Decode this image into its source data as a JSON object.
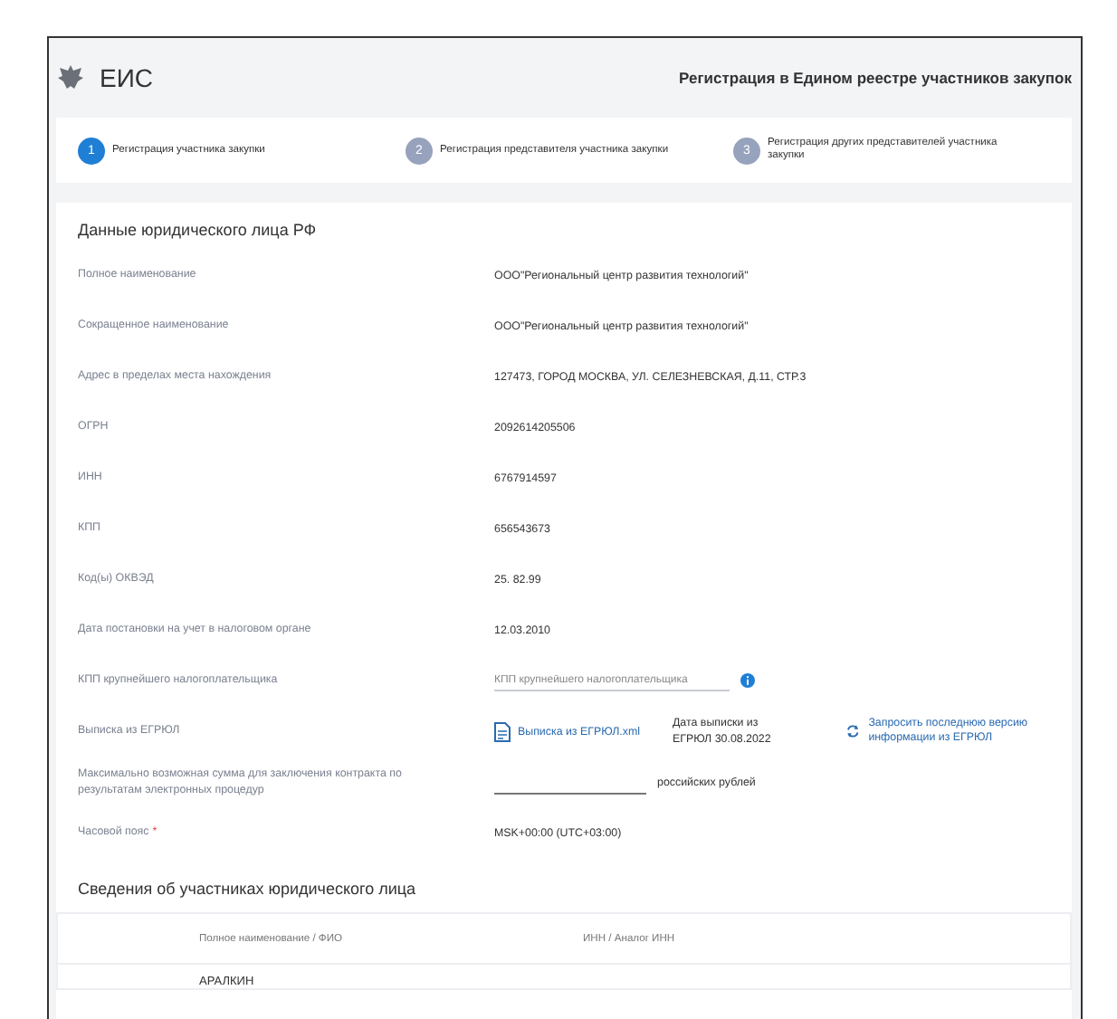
{
  "header": {
    "logo": "ЕИС",
    "title": "Регистрация в Едином реестре участников закупок"
  },
  "steps": [
    {
      "number": "1",
      "label": "Регистрация участника закупки",
      "selected": true
    },
    {
      "number": "2",
      "label": "Регистрация представителя участника закупки",
      "selected": false
    },
    {
      "number": "3",
      "label": "Регистрация других представителей участника закупки",
      "selected": false
    }
  ],
  "section": {
    "title": "Данные юридического лица РФ",
    "fields": [
      {
        "kind": "text",
        "label": "Полное наименование",
        "value": "ООО\"Региональный центр развития технологий\""
      },
      {
        "kind": "text",
        "label": "Сокращенное наименование",
        "value": "ООО\"Региональный центр развития технологий\""
      },
      {
        "kind": "text",
        "label": "Адрес в пределах места нахождения",
        "value": "127473, ГОРОД МОСКВА, УЛ. СЕЛЕЗНЕВСКАЯ, Д.11, СТР.3"
      },
      {
        "kind": "text",
        "label": "ОГРН",
        "value": "2092614205506"
      },
      {
        "kind": "text",
        "label": "ИНН",
        "value": "6767914597"
      },
      {
        "kind": "text",
        "label": "КПП",
        "value": "656543673"
      },
      {
        "kind": "text",
        "label": "Код(ы) ОКВЭД",
        "value": "25. 82.99"
      },
      {
        "kind": "text",
        "label": "Дата постановки на учет в налоговом органе",
        "value": "12.03.2010"
      },
      {
        "kind": "input",
        "label": "КПП крупнейшего налогоплательщика",
        "placeholder": "КПП крупнейшего налогоплательщика"
      },
      {
        "kind": "extract",
        "label": "Выписка из ЕГРЮЛ",
        "file": "Выписка из ЕГРЮЛ.xml",
        "date": "Дата выписки из ЕГРЮЛ 30.08.2022",
        "action": "Запросить последнюю версию информации из ЕГРЮЛ"
      },
      {
        "kind": "amount",
        "label": "Максимально возможная сумма для заключения контракта по результатам электронных процедур",
        "unit": "российских рублей"
      },
      {
        "kind": "text",
        "label": "Часовой пояс",
        "required_mark": "*",
        "value": "MSK+00:00 (UTC+03:00)"
      }
    ]
  },
  "participants": {
    "title": "Сведения об участниках юридического лица",
    "columns": [
      "Полное наименование / ФИО",
      "ИНН / Аналог ИНН"
    ],
    "rows": [
      [
        "АРАЛКИН"
      ]
    ]
  }
}
